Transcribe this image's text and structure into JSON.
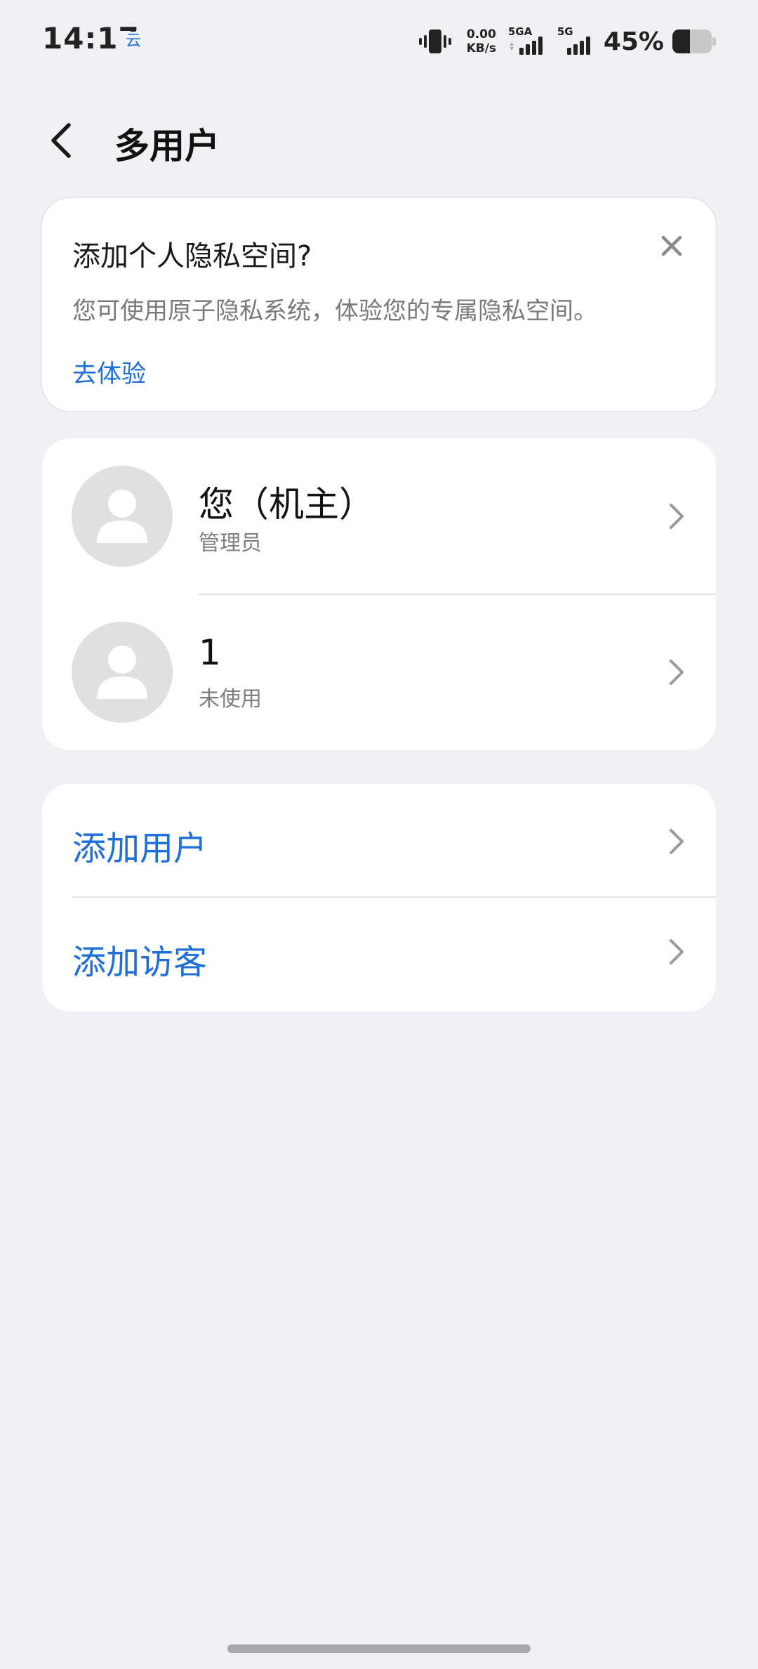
{
  "status_bar": {
    "time": "14:17",
    "app_icon": "云",
    "net_speed_value": "0.00",
    "net_speed_unit": "KB/s",
    "sim1_label": "5GA",
    "sim2_label": "5G",
    "battery_percent": "45%",
    "battery_level": 0.45
  },
  "header": {
    "title": "多用户"
  },
  "promo": {
    "title": "添加个人隐私空间?",
    "description": "您可使用原子隐私系统，体验您的专属隐私空间。",
    "link": "去体验"
  },
  "users": [
    {
      "name": "您（机主）",
      "role": "管理员"
    },
    {
      "name": "1",
      "role": "未使用"
    }
  ],
  "actions": {
    "add_user": "添加用户",
    "add_guest": "添加访客"
  },
  "colors": {
    "accent": "#1e6fd9",
    "background": "#f1f1f3",
    "card": "#ffffff"
  }
}
